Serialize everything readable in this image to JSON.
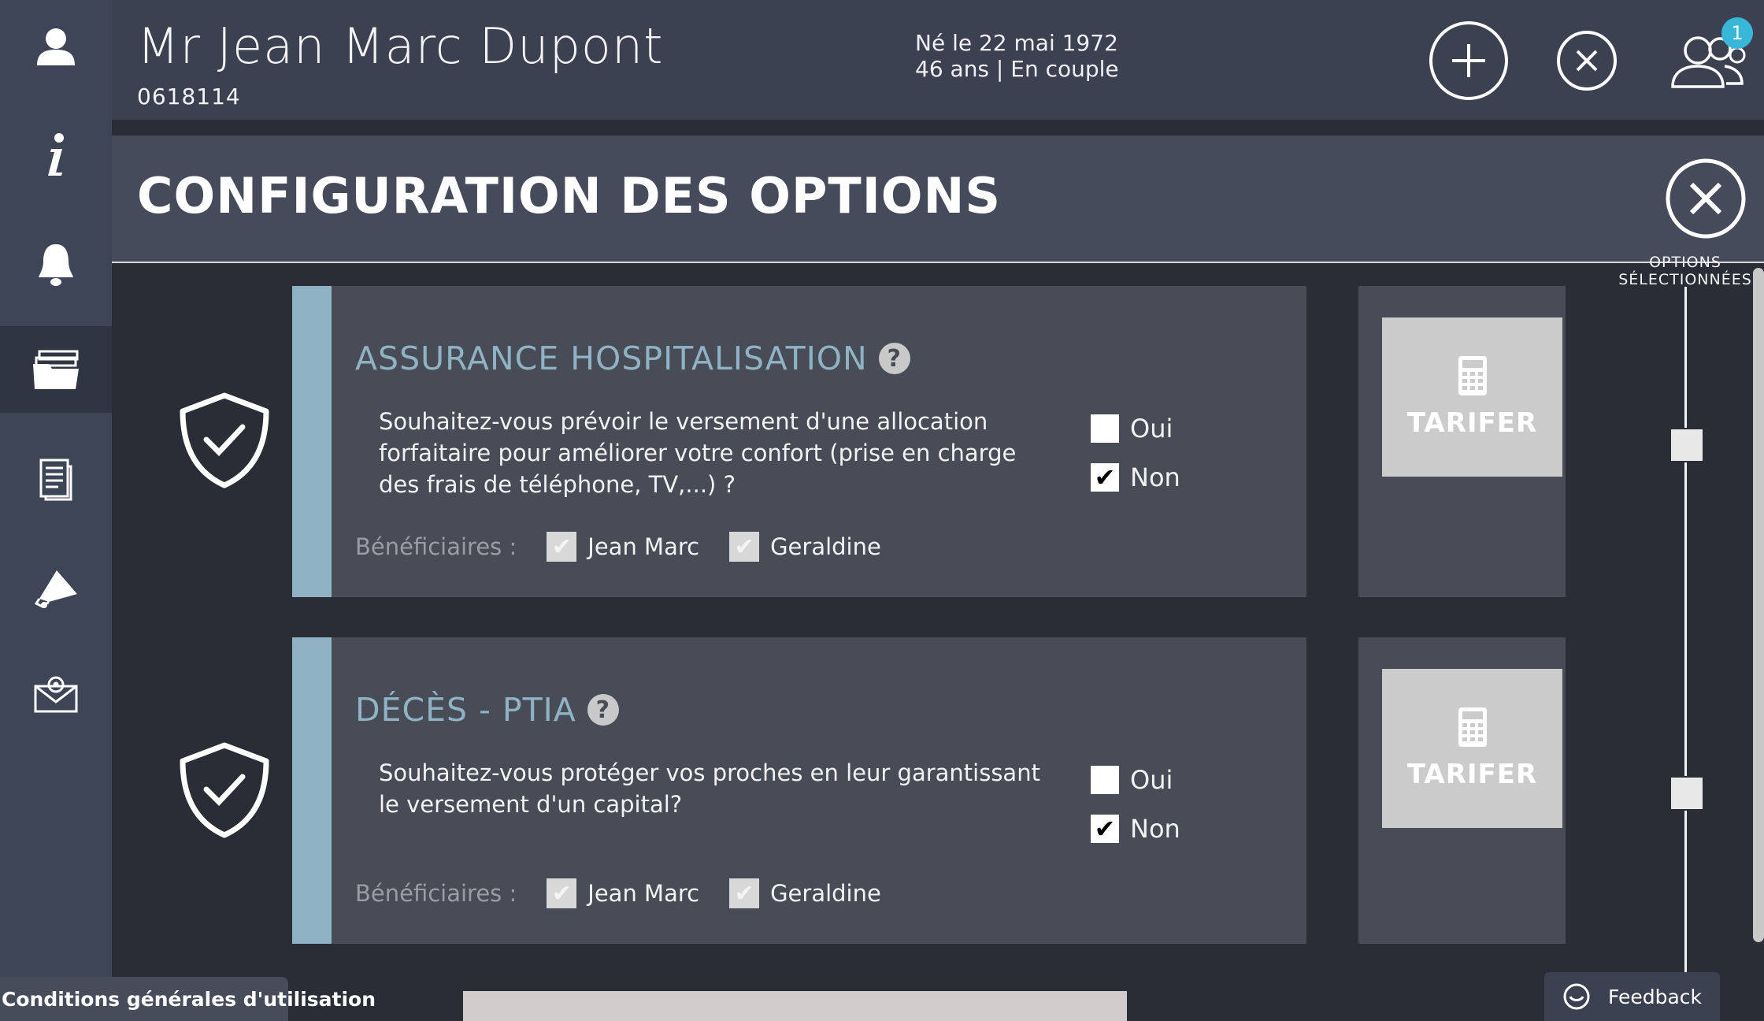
{
  "client": {
    "name": "Mr Jean Marc Dupont",
    "id": "0618114",
    "birth": "Né le 22 mai 1972",
    "status": "46 ans | En couple"
  },
  "header": {
    "notification_count": "1"
  },
  "modal": {
    "title": "CONFIGURATION DES OPTIONS",
    "selected_options_label": "OPTIONS SÉLECTIONNÉES"
  },
  "options": [
    {
      "title": "ASSURANCE HOSPITALISATION",
      "question": "Souhaitez-vous prévoir le versement d'une allocation forfaitaire pour améliorer votre confort (prise en charge des frais de téléphone, TV,...) ?",
      "oui_label": "Oui",
      "non_label": "Non",
      "selected": "Non",
      "beneficiaires_label": "Bénéficiaires :",
      "beneficiaries": [
        "Jean Marc",
        "Geraldine"
      ],
      "tarifer_label": "TARIFER"
    },
    {
      "title": "DÉCÈS - PTIA",
      "question": "Souhaitez-vous protéger vos proches en leur garantissant le versement d'un capital?",
      "oui_label": "Oui",
      "non_label": "Non",
      "selected": "Non",
      "beneficiaires_label": "Bénéficiaires :",
      "beneficiaries": [
        "Jean Marc",
        "Geraldine"
      ],
      "tarifer_label": "TARIFER"
    }
  ],
  "footer": {
    "cgu_label": "Conditions générales d'utilisation",
    "feedback_label": "Feedback"
  },
  "icons": {
    "sidebar": [
      "user-icon",
      "info-icon",
      "bell-icon",
      "folders-icon",
      "document-icon",
      "megaphone-icon",
      "mail-icon"
    ],
    "header": [
      "add-circle-icon",
      "close-circle-icon",
      "group-icon"
    ]
  },
  "colors": {
    "accent": "#8fb3c4",
    "badge": "#39b7d8",
    "sidebar": "#3e4556"
  }
}
